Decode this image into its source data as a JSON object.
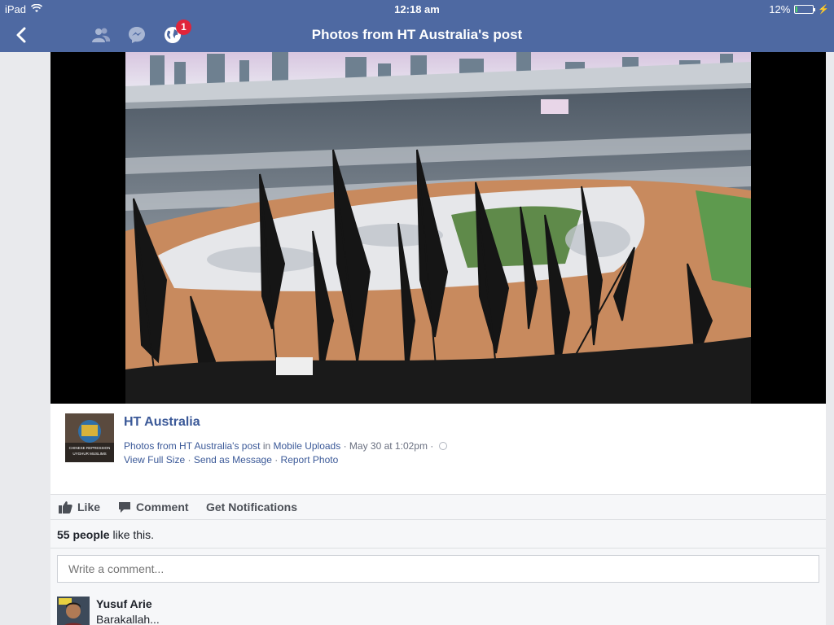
{
  "status_bar": {
    "device": "iPad",
    "time": "12:18 am",
    "battery": "12%",
    "battery_level": 0.12
  },
  "nav": {
    "title": "Photos from HT Australia's post",
    "notification_count": "1"
  },
  "post": {
    "page_name": "HT Australia",
    "album_prefix": "Photos from HT Australia's post",
    "in_word": "in",
    "album_name": "Mobile Uploads",
    "date": "May 30 at 1:02pm",
    "separator": " · ",
    "links": {
      "view_full_size": "View Full Size",
      "send_as_message": "Send as Message",
      "report_photo": "Report Photo"
    },
    "thumb_text": {
      "line1": "CHINESE REPRESSION",
      "line2": "UYGHUR MUSLIMS"
    }
  },
  "actions": {
    "like": "Like",
    "comment": "Comment",
    "notifications": "Get Notifications"
  },
  "likes": {
    "count_text": "55 people",
    "suffix": "like this."
  },
  "comment_box": {
    "placeholder": "Write a comment..."
  },
  "comments": [
    {
      "author": "Yusuf Arie",
      "text": "Barakallah..."
    }
  ],
  "colors": {
    "header_blue": "#4e69a2",
    "link_blue": "#3b5998",
    "badge_red": "#e0243a"
  }
}
